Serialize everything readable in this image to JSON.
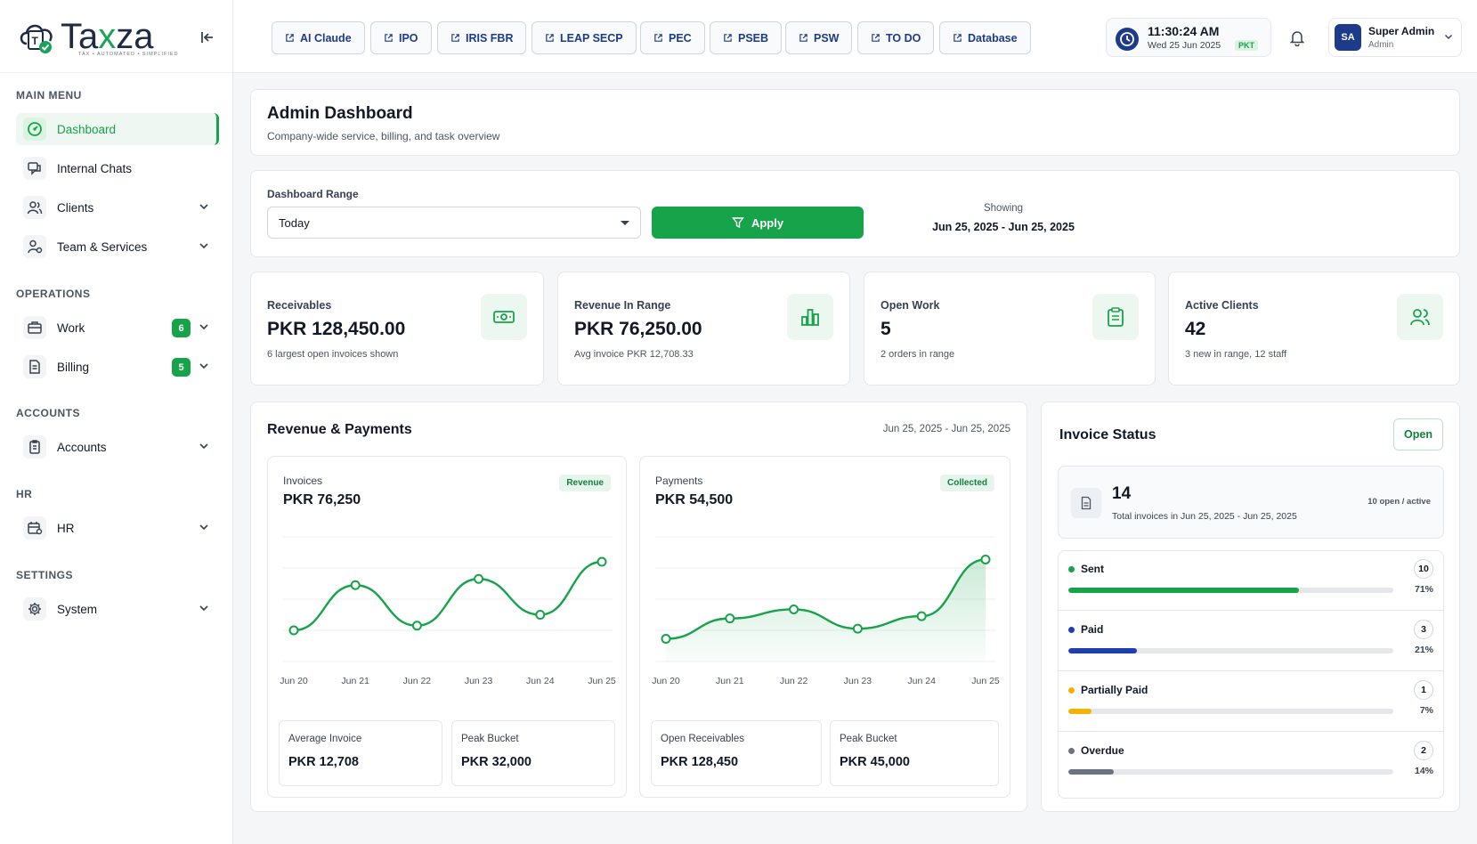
{
  "brand": {
    "name_a": "Ta",
    "name_x": "x",
    "name_b": "za",
    "tagline": "TAX • AUTOMATED • SIMPLIFIED"
  },
  "sidebar": {
    "sections": [
      {
        "title": "MAIN MENU"
      },
      {
        "title": "OPERATIONS"
      },
      {
        "title": "ACCOUNTS"
      },
      {
        "title": "HR"
      },
      {
        "title": "SETTINGS"
      }
    ],
    "items": [
      {
        "label": "Dashboard",
        "icon": "gauge-icon",
        "active": true
      },
      {
        "label": "Internal Chats",
        "icon": "chat-icon"
      },
      {
        "label": "Clients",
        "icon": "users-icon"
      },
      {
        "label": "Team & Services",
        "icon": "team-icon"
      },
      {
        "label": "Work",
        "icon": "briefcase-icon",
        "badge": "6"
      },
      {
        "label": "Billing",
        "icon": "receipt-icon",
        "badge": "5"
      },
      {
        "label": "Accounts",
        "icon": "ledger-icon"
      },
      {
        "label": "HR",
        "icon": "calendar-user-icon"
      },
      {
        "label": "System",
        "icon": "gear-icon"
      }
    ]
  },
  "topbar": {
    "quick_links": [
      "AI Claude",
      "IPO",
      "IRIS FBR",
      "LEAP SECP",
      "PEC",
      "PSEB",
      "PSW",
      "TO DO",
      "Database"
    ],
    "clock": {
      "time": "11:30:24 AM",
      "date": "Wed 25 Jun 2025",
      "tz": "PKT"
    },
    "user": {
      "initials": "SA",
      "name": "Super Admin",
      "role": "Admin"
    }
  },
  "header": {
    "title": "Admin Dashboard",
    "subtitle": "Company-wide service, billing, and task overview"
  },
  "range": {
    "label": "Dashboard Range",
    "selected": "Today",
    "apply_label": "Apply",
    "showing_label": "Showing",
    "showing_value": "Jun 25, 2025 - Jun 25, 2025"
  },
  "kpis": [
    {
      "label": "Receivables",
      "value": "PKR 128,450.00",
      "note": "6 largest open invoices shown",
      "icon": "cash-icon"
    },
    {
      "label": "Revenue In Range",
      "value": "PKR 76,250.00",
      "note": "Avg invoice PKR 12,708.33",
      "icon": "bar-chart-icon"
    },
    {
      "label": "Open Work",
      "value": "5",
      "note": "2 orders in range",
      "icon": "clipboard-icon"
    },
    {
      "label": "Active Clients",
      "value": "42",
      "note": "3 new in range, 12 staff",
      "icon": "users-icon"
    }
  ],
  "revenue": {
    "title": "Revenue & Payments",
    "range": "Jun 25, 2025 - Jun 25, 2025",
    "invoices": {
      "label": "Invoices",
      "chip": "Revenue",
      "total": "PKR 76,250",
      "stats": [
        {
          "label": "Average Invoice",
          "value": "PKR 12,708"
        },
        {
          "label": "Peak Bucket",
          "value": "PKR 32,000"
        }
      ]
    },
    "payments": {
      "label": "Payments",
      "chip": "Collected",
      "total": "PKR 54,500",
      "stats": [
        {
          "label": "Open Receivables",
          "value": "PKR 128,450"
        },
        {
          "label": "Peak Bucket",
          "value": "PKR 45,000"
        }
      ]
    }
  },
  "chart_data": [
    {
      "type": "line",
      "x": [
        "Jun 20",
        "Jun 21",
        "Jun 22",
        "Jun 23",
        "Jun 24",
        "Jun 25"
      ],
      "series": [
        {
          "values": [
            10000,
            24500,
            11500,
            26500,
            15000,
            32000
          ]
        }
      ],
      "ylim": [
        0,
        40000
      ],
      "grid": true,
      "color": "#16a34a"
    },
    {
      "type": "area",
      "x": [
        "Jun 20",
        "Jun 21",
        "Jun 22",
        "Jun 23",
        "Jun 24",
        "Jun 25"
      ],
      "series": [
        {
          "values": [
            10000,
            19000,
            23000,
            14500,
            20000,
            45000
          ]
        }
      ],
      "ylim": [
        0,
        55000
      ],
      "grid": true,
      "color": "#16a34a"
    }
  ],
  "invoice_status": {
    "title": "Invoice Status",
    "open_label": "Open",
    "total": "14",
    "total_note": "Total invoices in Jun 25, 2025 - Jun 25, 2025",
    "open_active": "10 open / active",
    "rows": [
      {
        "name": "Sent",
        "count": "10",
        "pct": "71%",
        "fraction": 0.71,
        "color": "#16a34a"
      },
      {
        "name": "Paid",
        "count": "3",
        "pct": "21%",
        "fraction": 0.21,
        "color": "#1e40af"
      },
      {
        "name": "Partially Paid",
        "count": "1",
        "pct": "7%",
        "fraction": 0.07,
        "color": "#f5b301"
      },
      {
        "name": "Overdue",
        "count": "2",
        "pct": "14%",
        "fraction": 0.14,
        "color": "#6b7280"
      }
    ]
  }
}
